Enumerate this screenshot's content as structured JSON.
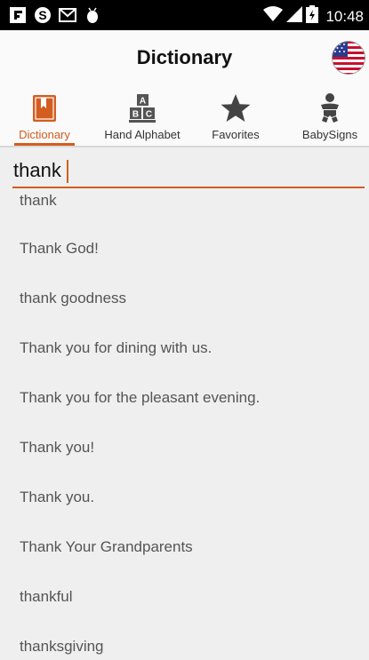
{
  "status_bar": {
    "time": "10:48",
    "left_icons": [
      "flipboard-icon",
      "skype-icon",
      "gmail-icon",
      "android-debug-icon"
    ],
    "right_icons": [
      "wifi-icon",
      "signal-icon",
      "battery-charging-icon"
    ]
  },
  "header": {
    "title": "Dictionary",
    "language_icon": "us-flag-icon"
  },
  "tabs": [
    {
      "label": "Dictionary",
      "icon": "bookmark-book-icon",
      "active": true
    },
    {
      "label": "Hand Alphabet",
      "icon": "abc-blocks-icon",
      "active": false
    },
    {
      "label": "Favorites",
      "icon": "star-icon",
      "active": false
    },
    {
      "label": "BabySigns",
      "icon": "baby-icon",
      "active": false
    }
  ],
  "search": {
    "value": "thank"
  },
  "results": [
    "thank",
    "Thank God!",
    "thank goodness",
    "Thank you for dining with us.",
    "Thank you for the pleasant evening.",
    "Thank you!",
    "Thank you.",
    "Thank Your Grandparents",
    "thankful",
    "thanksgiving"
  ],
  "colors": {
    "accent": "#d35d1f",
    "background": "#efefef",
    "header_bg": "#fafafa",
    "status_bar": "#000000"
  }
}
